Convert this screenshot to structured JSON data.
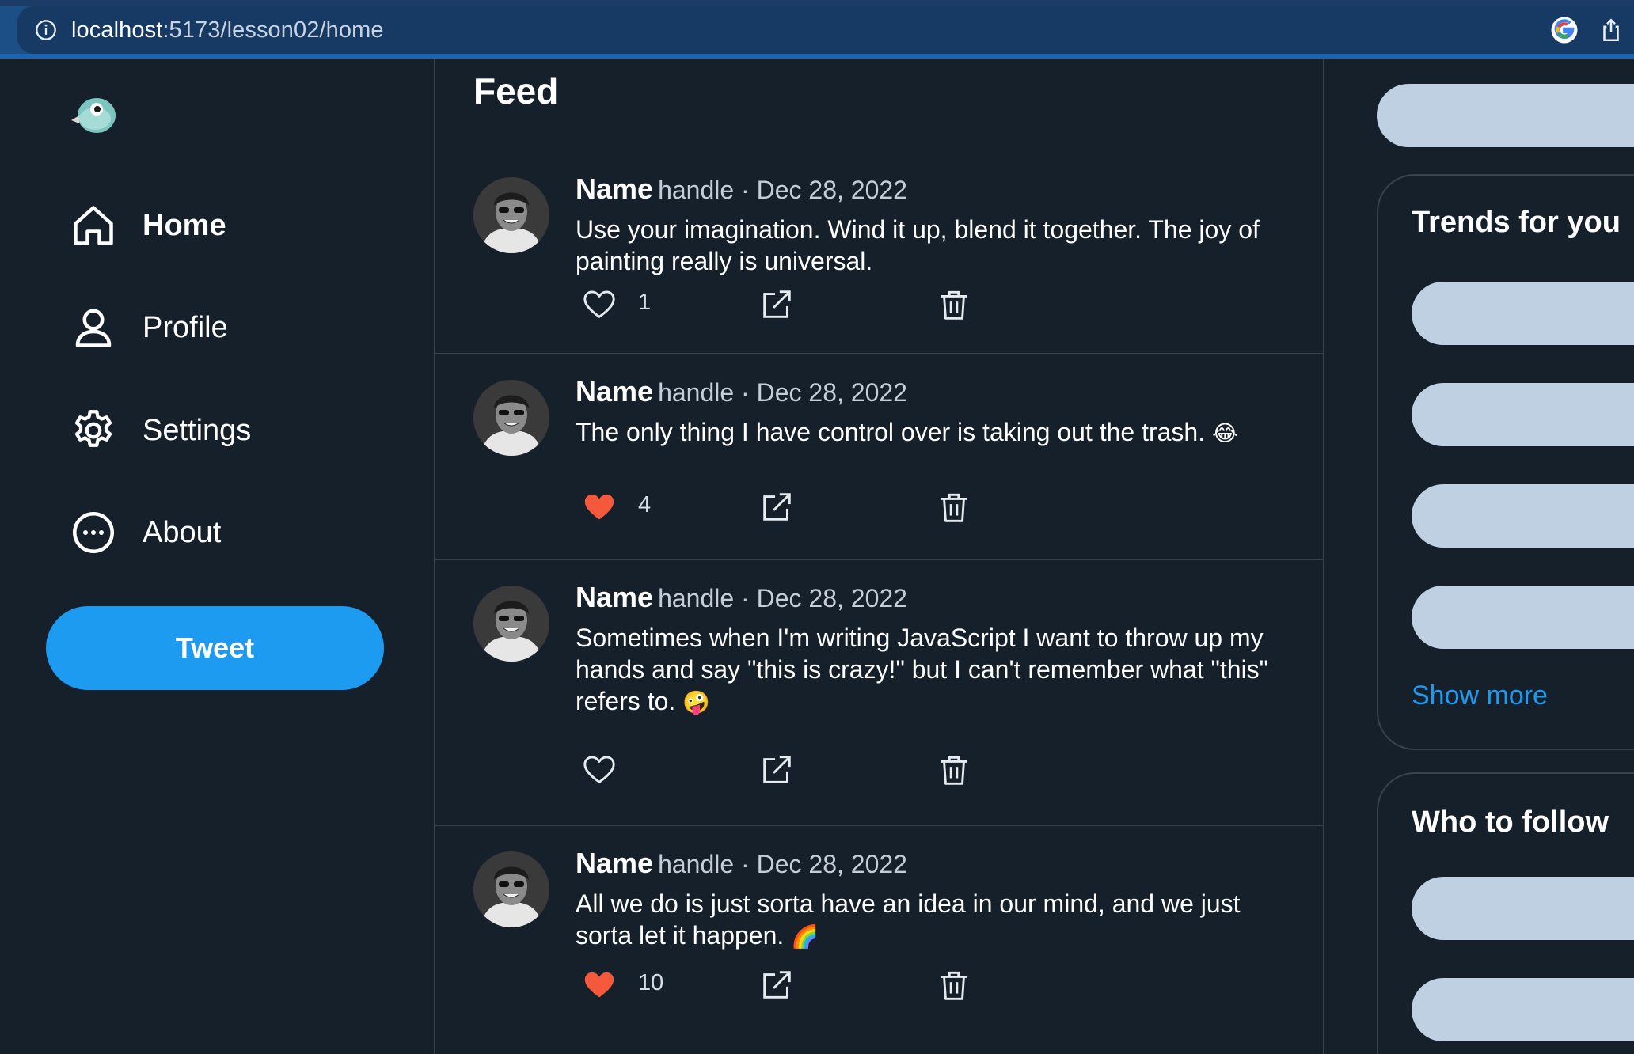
{
  "browser": {
    "url_host": "localhost",
    "url_path": ":5173/lesson02/home"
  },
  "sidebar": {
    "items": [
      {
        "label": "Home",
        "icon": "home-icon",
        "active": true
      },
      {
        "label": "Profile",
        "icon": "user-icon",
        "active": false
      },
      {
        "label": "Settings",
        "icon": "gear-icon",
        "active": false
      },
      {
        "label": "About",
        "icon": "more-circle-icon",
        "active": false
      }
    ],
    "tweet_button": "Tweet"
  },
  "feed": {
    "title": "Feed",
    "posts": [
      {
        "name": "Name",
        "meta": "handle · Dec 28, 2022",
        "text": "Use your imagination. Wind it up, blend it together. The joy of painting really is universal.",
        "emoji": "",
        "liked": false,
        "likes": "1"
      },
      {
        "name": "Name",
        "meta": "handle · Dec 28, 2022",
        "text": "The only thing I have control over is taking out the trash.",
        "emoji": "😂",
        "liked": true,
        "likes": "4"
      },
      {
        "name": "Name",
        "meta": "handle · Dec 28, 2022",
        "text": "Sometimes when I'm writing JavaScript I want to throw up my hands and say \"this is crazy!\" but I can't remember what \"this\" refers to.",
        "emoji": "🤪",
        "liked": false,
        "likes": ""
      },
      {
        "name": "Name",
        "meta": "handle · Dec 28, 2022",
        "text": "All we do is just sorta have an idea in our mind, and we just sorta let it happen.",
        "emoji": "🌈",
        "liked": true,
        "likes": "10"
      }
    ]
  },
  "right_sidebar": {
    "trends_title": "Trends for you",
    "show_more": "Show more",
    "follow_title": "Who to follow"
  },
  "colors": {
    "background": "#15202b",
    "accent": "#1d9bf0",
    "like": "#f4593c",
    "placeholder": "#bfd0e2"
  }
}
